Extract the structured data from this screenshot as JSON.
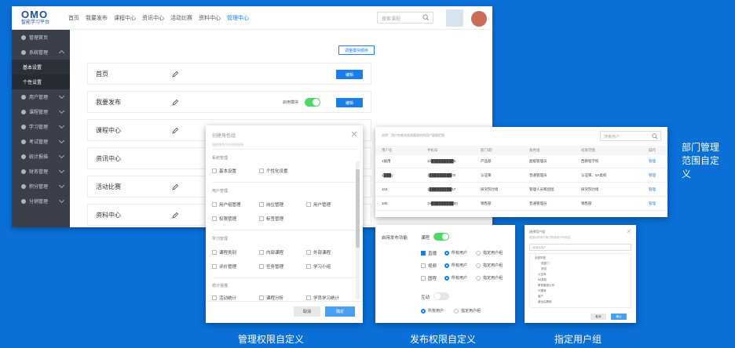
{
  "header": {
    "logo": "OMO",
    "logo_sub": "智能学习平台",
    "nav": [
      "首页",
      "我要发布",
      "课程中心",
      "资讯中心",
      "活动比赛",
      "资料中心",
      "管理中心"
    ],
    "search_placeholder": "搜索课程"
  },
  "sidebar": {
    "items": [
      {
        "label": "管理首页"
      },
      {
        "label": "系统管理"
      },
      {
        "label": "基本设置"
      },
      {
        "label": "个性设置"
      },
      {
        "label": "用户管理"
      },
      {
        "label": "课程管理"
      },
      {
        "label": "学习管理"
      },
      {
        "label": "考试管理"
      },
      {
        "label": "统计报描"
      },
      {
        "label": "财务管理"
      },
      {
        "label": "积分管理"
      },
      {
        "label": "分销管理"
      }
    ]
  },
  "main": {
    "sort_button": "调整模块顺序",
    "rows": [
      {
        "label": "首页",
        "button": "编辑"
      },
      {
        "label": "我要发布",
        "toggle_label": "启用模块",
        "button": "编辑"
      },
      {
        "label": "课程中心"
      },
      {
        "label": "资讯中心"
      },
      {
        "label": "活动比赛"
      },
      {
        "label": "资料中心"
      }
    ]
  },
  "role_dialog": {
    "title": "创建角色组",
    "hint": "选择角色可访问的权限",
    "groups": [
      {
        "name": "系统管理",
        "options": [
          "基本设置",
          "个性化设置"
        ]
      },
      {
        "name": "用户管理",
        "options": [
          "用户组管理",
          "岗位管理",
          "用户管理",
          "权限管理",
          "标签管理"
        ]
      },
      {
        "name": "学习管理",
        "options": [
          "课程类别",
          "内部课程",
          "外部课程",
          "评价管理",
          "任务管理",
          "学习小组"
        ]
      },
      {
        "name": "统计报描",
        "options": [
          "活动统计",
          "课程分析",
          "学员学习统计"
        ]
      }
    ],
    "cancel": "取消",
    "confirm": "确定"
  },
  "dept_table": {
    "hint": "说明：用户在能浏览和管理的的用户管理范围",
    "search_placeholder": "搜索用户",
    "columns": [
      "用户名",
      "手机号",
      "部门/职",
      "角色组",
      "权限范围",
      "操作"
    ],
    "rows": [
      [
        "1拨用",
        "18█████████9",
        "产品部",
        "超级管理员",
        "西教程学校",
        "管理"
      ],
      [
        "1███y",
        "1█████████00",
        "认证库",
        "普通管理员",
        "认证库、5A类校",
        "管理"
      ],
      [
        "104",
        "1█████████57",
        "研究院讨组",
        "管理人员和团团",
        "研究院讨组",
        "管理"
      ],
      [
        "105",
        "19█████████00",
        "销售部",
        "普通管理员",
        "销售部",
        "管理"
      ]
    ]
  },
  "publish": {
    "label": "启用发布功能",
    "course": "课程",
    "types": [
      {
        "name": "直播",
        "checked": true
      },
      {
        "name": "视频",
        "checked": false
      },
      {
        "name": "图程",
        "checked": false
      }
    ],
    "all_users": "所有用户",
    "specific_group": "指定用户组",
    "interaction": "互动"
  },
  "user_group": {
    "title": "选择用户组",
    "hint": "被选中的用户组下所有用户均可见",
    "placeholder": "请选择用户",
    "tree": [
      "全部学校",
      "现部门",
      "测试",
      "认证库",
      "5A类校",
      "教育集团公司",
      "代理商",
      "客户",
      "营运后期组"
    ],
    "cancel": "取消",
    "confirm": "确认"
  },
  "captions": {
    "side": "部门管理范围自定义",
    "c1": "管理权限自定义",
    "c2": "发布权限自定义",
    "c3": "指定用户组"
  }
}
